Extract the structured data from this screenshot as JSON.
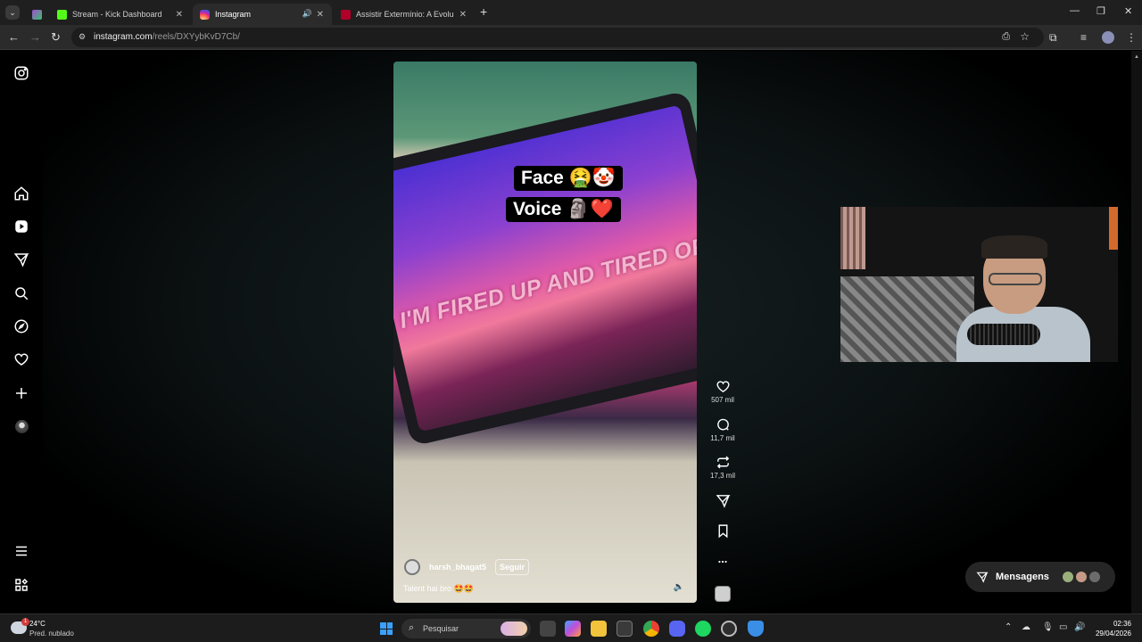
{
  "browser": {
    "tabs": [
      {
        "label": "",
        "active": false
      },
      {
        "label": "Stream - Kick Dashboard",
        "active": false
      },
      {
        "label": "Instagram",
        "active": true
      },
      {
        "label": "Assistir Extermínio: A Evolução",
        "active": false
      }
    ],
    "new_tab": "+",
    "url_host": "instagram.com",
    "url_path": "/reels/DXYybKvD7Cb/"
  },
  "reel": {
    "overlay_line1": "Face 🤮🤡",
    "overlay_line2": "Voice 🗿❤️",
    "lyric": "I'M FIRED UP AND TIRED OF",
    "username": "harsh_bhagat5",
    "follow_label": "Seguir",
    "caption": "Talent hai bro 🤩🤩"
  },
  "actions": {
    "likes": "507 mil",
    "comments": "11,7 mil",
    "reposts": "17,3 mil",
    "more": "..."
  },
  "messages": {
    "label": "Mensagens"
  },
  "taskbar": {
    "weather_temp": "24°C",
    "weather_desc": "Pred. nublado",
    "weather_badge": "1",
    "search_placeholder": "Pesquisar",
    "time": "02:36",
    "date": "29/04/2026"
  },
  "colors": {
    "accent_blue": "#3aa0ff",
    "kick_green": "#53fc18",
    "instagram_pink": "#e1306c"
  }
}
